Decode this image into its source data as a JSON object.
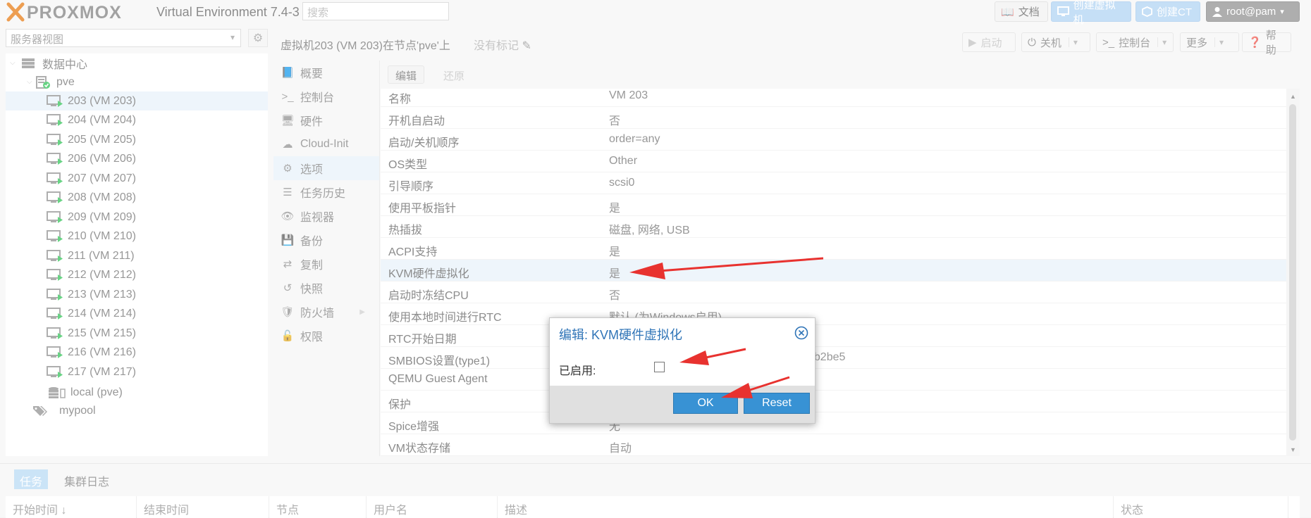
{
  "header": {
    "logo_text": "PROXMOX",
    "version": "Virtual Environment 7.4-3",
    "search_placeholder": "搜索",
    "docs": "文档",
    "create_vm": "创建虚拟机",
    "create_ct": "创建CT",
    "user": "root@pam"
  },
  "sidebar": {
    "view": "服务器视图",
    "datacenter": "数据中心",
    "node": "pve",
    "vms": [
      "203 (VM 203)",
      "204 (VM 204)",
      "205 (VM 205)",
      "206 (VM 206)",
      "207 (VM 207)",
      "208 (VM 208)",
      "209 (VM 209)",
      "210 (VM 210)",
      "211 (VM 211)",
      "212 (VM 212)",
      "213 (VM 213)",
      "214 (VM 214)",
      "215 (VM 215)",
      "216 (VM 216)",
      "217 (VM 217)"
    ],
    "storage": "local (pve)",
    "pool": "mypool"
  },
  "main": {
    "title": "虚拟机203 (VM 203)在节点'pve'上",
    "tags": "没有标记",
    "buttons": {
      "start": "启动",
      "shutdown": "关机",
      "console": "控制台",
      "more": "更多",
      "help": "帮助"
    },
    "nav": [
      "概要",
      "控制台",
      "硬件",
      "Cloud-Init",
      "选项",
      "任务历史",
      "监视器",
      "备份",
      "复制",
      "快照",
      "防火墙",
      "权限"
    ],
    "nav_selected": "选项",
    "grid_toolbar": {
      "edit": "编辑",
      "revert": "还原"
    },
    "options": [
      {
        "k": "名称",
        "v": "VM 203"
      },
      {
        "k": "开机自启动",
        "v": "否"
      },
      {
        "k": "启动/关机顺序",
        "v": "order=any"
      },
      {
        "k": "OS类型",
        "v": "Other"
      },
      {
        "k": "引导顺序",
        "v": "scsi0"
      },
      {
        "k": "使用平板指针",
        "v": "是"
      },
      {
        "k": "热插拔",
        "v": "磁盘, 网络, USB"
      },
      {
        "k": "ACPI支持",
        "v": "是"
      },
      {
        "k": "KVM硬件虚拟化",
        "v": "是"
      },
      {
        "k": "启动时冻结CPU",
        "v": "否"
      },
      {
        "k": "使用本地时间进行RTC",
        "v": "默认 (为Windows启用)"
      },
      {
        "k": "RTC开始日期",
        "v": ""
      },
      {
        "k": "SMBIOS设置(type1)",
        "v": "eb2be5"
      },
      {
        "k": "QEMU Guest Agent",
        "v": ""
      },
      {
        "k": "保护",
        "v": ""
      },
      {
        "k": "Spice增强",
        "v": "无"
      },
      {
        "k": "VM状态存储",
        "v": "自动"
      }
    ]
  },
  "bottom": {
    "tabs": [
      "任务",
      "集群日志"
    ],
    "columns": [
      "开始时间 ↓",
      "结束时间",
      "节点",
      "用户名",
      "描述",
      "状态"
    ]
  },
  "dialog": {
    "title": "编辑: KVM硬件虚拟化",
    "label": "已启用:",
    "checked": false,
    "ok": "OK",
    "reset": "Reset"
  },
  "colors": {
    "accent": "#3892d4",
    "selection": "#e6f0f9",
    "logo_orange": "#e57000",
    "arrow": "#e8322f"
  }
}
